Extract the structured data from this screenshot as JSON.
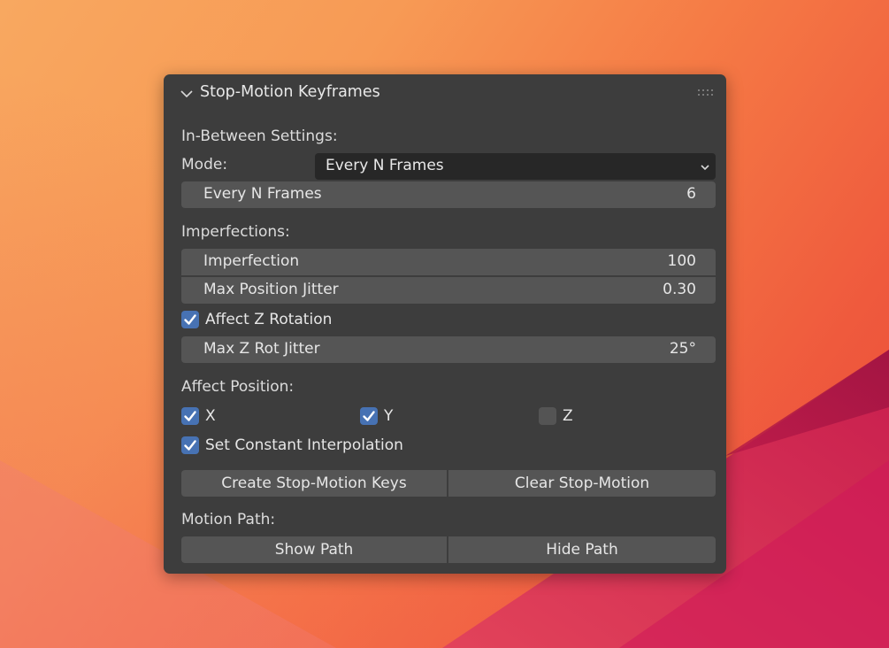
{
  "panel": {
    "title": "Stop-Motion Keyframes"
  },
  "inbetween": {
    "section_label": "In-Between Settings:",
    "mode_label": "Mode:",
    "mode_value": "Every N Frames",
    "every_n_label": "Every N Frames",
    "every_n_value": "6"
  },
  "imperfections": {
    "section_label": "Imperfections:",
    "imperfection_label": "Imperfection",
    "imperfection_value": "100",
    "max_pos_jitter_label": "Max Position Jitter",
    "max_pos_jitter_value": "0.30",
    "affect_z_rotation_label": "Affect Z Rotation",
    "affect_z_rotation_checked": true,
    "max_z_rot_label": "Max Z Rot Jitter",
    "max_z_rot_value": "25°"
  },
  "affect_position": {
    "section_label": "Affect Position:",
    "x_label": "X",
    "x_checked": true,
    "y_label": "Y",
    "y_checked": true,
    "z_label": "Z",
    "z_checked": false,
    "constant_interp_label": "Set Constant Interpolation",
    "constant_interp_checked": true
  },
  "actions": {
    "create_label": "Create Stop-Motion Keys",
    "clear_label": "Clear Stop-Motion"
  },
  "motion_path": {
    "section_label": "Motion Path:",
    "show_label": "Show Path",
    "hide_label": "Hide Path"
  },
  "colors": {
    "panel_bg": "#3d3d3d",
    "field_bg": "#555555",
    "select_bg": "#272727",
    "checkbox_on": "#4772b3"
  }
}
